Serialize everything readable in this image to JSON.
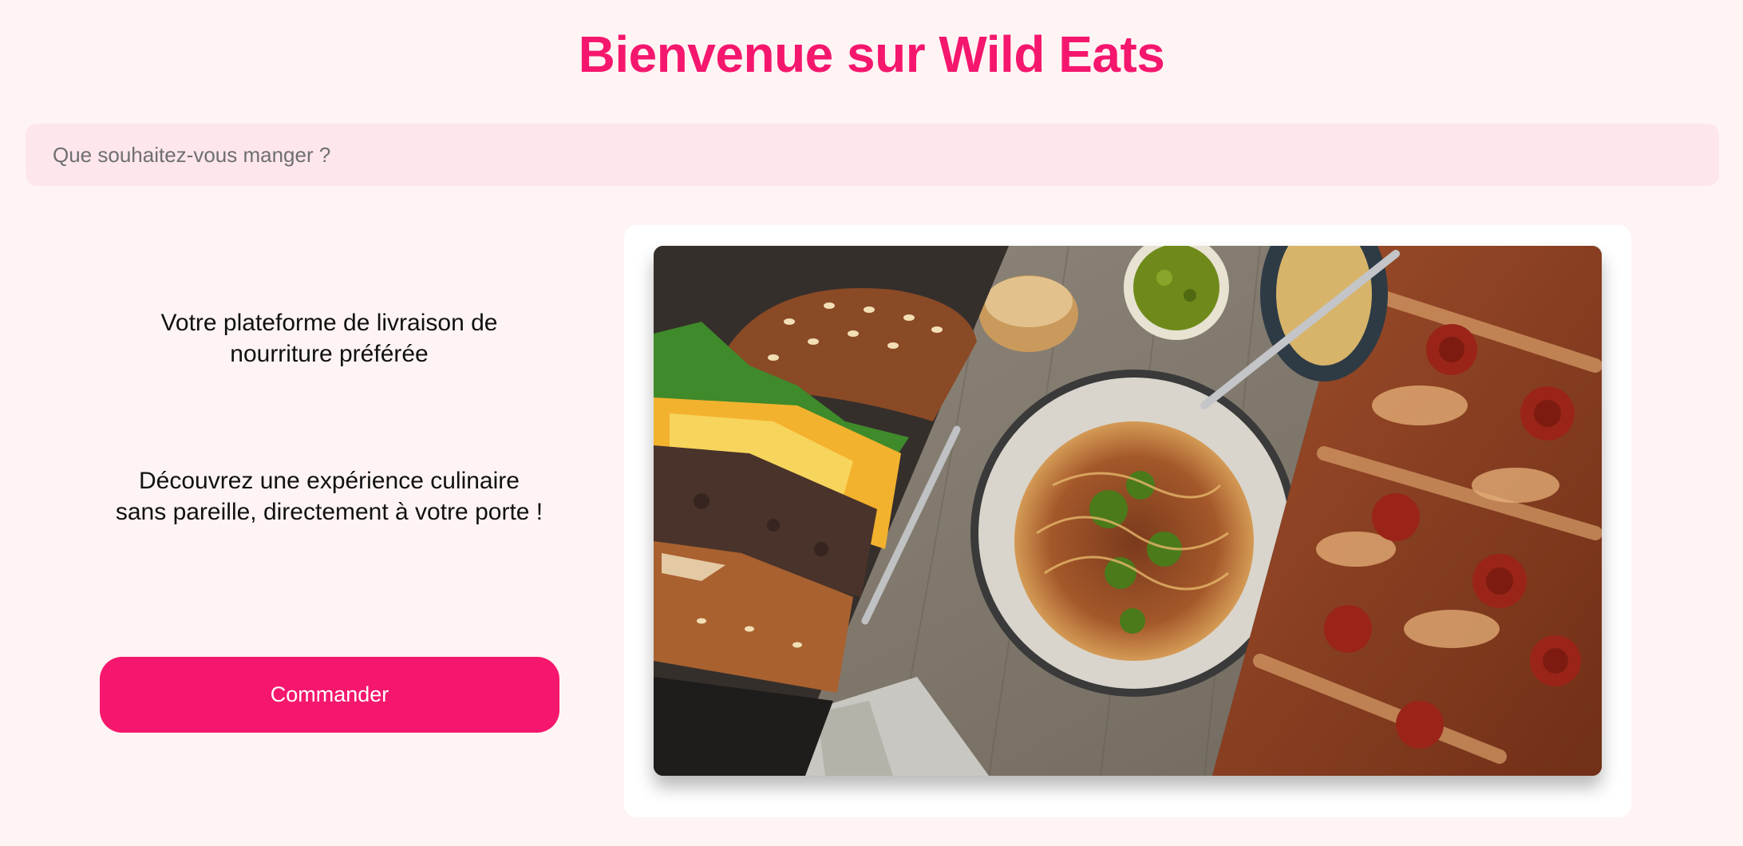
{
  "colors": {
    "accent": "#f5176d",
    "search_bg": "#fde6ec",
    "page_bg": "#fff4f4"
  },
  "header": {
    "title": "Bienvenue sur Wild Eats"
  },
  "search": {
    "placeholder": "Que souhaitez-vous manger ?",
    "value": ""
  },
  "hero": {
    "tagline": "Votre plateforme de livraison de nourriture préférée",
    "description": "Découvrez une expérience culinaire sans pareille, directement à votre porte !",
    "cta_label": "Commander"
  },
  "image": {
    "name": "food-collage-image",
    "panels": [
      "burger",
      "spaghetti-bolognese",
      "pepperoni-pizza"
    ]
  }
}
